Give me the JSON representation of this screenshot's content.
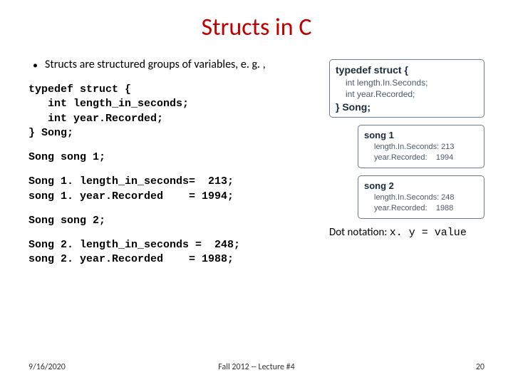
{
  "title": "Structs in C",
  "bullet": "Structs are structured groups of variables, e. g. ,",
  "code": {
    "typedef": "typedef struct {\n   int length_in_seconds;\n   int year.Recorded;\n} Song;",
    "decl1": "Song song 1;",
    "assign1": "Song 1. length_in_seconds=  213;\nsong 1. year.Recorded    = 1994;",
    "decl2": "Song song 2;",
    "assign2": "Song 2. length_in_seconds =  248;\nsong 2. year.Recorded    = 1988;"
  },
  "diagram": {
    "struct": {
      "head": "typedef struct {",
      "body": "int length.In.Seconds;\nint year.Recorded;",
      "foot": "} Song;"
    },
    "song1": {
      "head": "song 1",
      "body": "length.In.Seconds: 213\nyear.Recorded:    1994"
    },
    "song2": {
      "head": "song 2",
      "body": "length.In.Seconds: 248\nyear.Recorded:    1988"
    }
  },
  "caption_prefix": "Dot notation: ",
  "caption_mono": "x. y = value",
  "footer": {
    "date": "9/16/2020",
    "center": "Fall 2012 -- Lecture #4",
    "page": "20"
  }
}
